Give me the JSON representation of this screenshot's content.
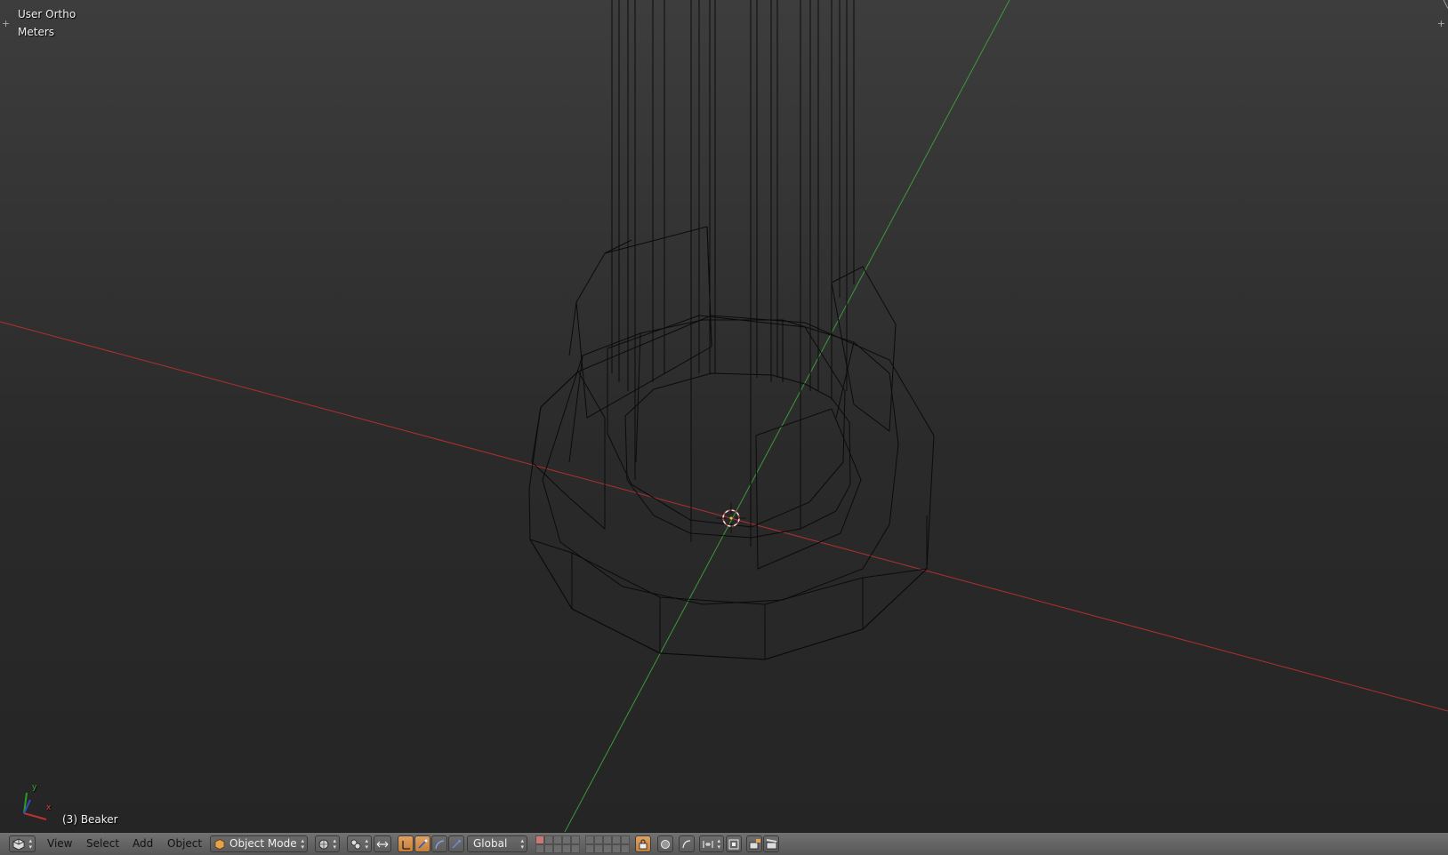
{
  "viewport": {
    "view_name": "User Ortho",
    "units": "Meters",
    "active_object": "(3) Beaker"
  },
  "axis_gizmo": {
    "y_label": "y",
    "x_label": "x"
  },
  "header": {
    "editor_type_icon": "3d-view-icon",
    "menus": [
      "View",
      "Select",
      "Add",
      "Object"
    ],
    "mode": {
      "icon": "cube-icon",
      "label": "Object Mode"
    },
    "shading_icon": "sphere-shading-icon",
    "pivot_icon": "pivot-point-icon",
    "manipulator_icon": "manipulator-icon",
    "transform_orientation": "Global",
    "layer_rows": 2,
    "snap_icon": "magnet-icon",
    "render_icon": "camera-render-icon",
    "render_anim_icon": "clapper-icon"
  },
  "colors": {
    "x_axis": "#b03030",
    "y_axis": "#3a9a3a",
    "wire": "#0b0b0b",
    "active_toggle": "#d89050"
  }
}
